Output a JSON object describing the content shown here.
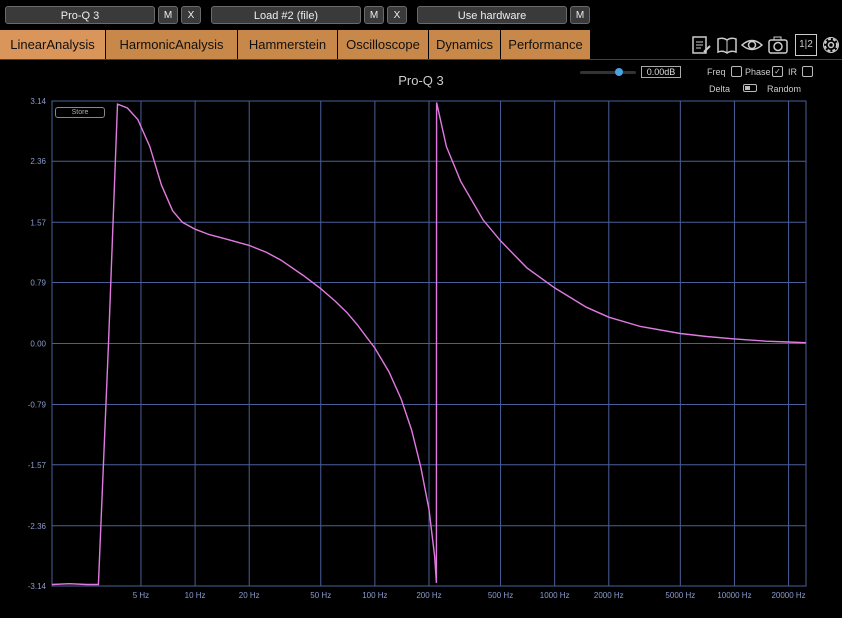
{
  "toolbar": {
    "plugin1_label": "Pro-Q 3",
    "plugin2_label": "Load #2 (file)",
    "hardware_label": "Use hardware",
    "m_label": "M",
    "x_label": "X"
  },
  "tabs": [
    {
      "label": "LinearAnalysis",
      "active": true
    },
    {
      "label": "HarmonicAnalysis",
      "active": false
    },
    {
      "label": "Hammerstein",
      "active": false
    },
    {
      "label": "Oscilloscope",
      "active": false
    },
    {
      "label": "Dynamics",
      "active": false
    },
    {
      "label": "Performance",
      "active": false
    }
  ],
  "icons": [
    "notes-icon",
    "book-icon",
    "eye-icon",
    "camera-icon",
    "split-view-icon",
    "gear-icon"
  ],
  "split_label": "1|2",
  "controls": {
    "gain_value": "0.00dB",
    "freq_label": "Freq",
    "phase_label": "Phase",
    "ir_label": "IR",
    "delta_label": "Delta",
    "random_label": "Random",
    "store_label": "Store"
  },
  "chart_data": {
    "type": "line",
    "title": "Pro-Q 3",
    "xscale": "log",
    "xlim": [
      1.6,
      25000
    ],
    "ylim": [
      -3.14,
      3.14
    ],
    "x_tick_labels": [
      "5 Hz",
      "10 Hz",
      "20 Hz",
      "50 Hz",
      "100 Hz",
      "200 Hz",
      "500 Hz",
      "1000 Hz",
      "2000 Hz",
      "5000 Hz",
      "10000 Hz",
      "20000 Hz"
    ],
    "x_ticks": [
      5,
      10,
      20,
      50,
      100,
      200,
      500,
      1000,
      2000,
      5000,
      10000,
      20000
    ],
    "y_ticks": [
      3.14,
      2.36,
      1.57,
      0.79,
      0.0,
      -0.79,
      -1.57,
      -2.36,
      -3.14
    ],
    "y_tick_labels": [
      "3.14",
      "2.36",
      "1.57",
      "0.79",
      "0.00",
      "-0.79",
      "-1.57",
      "-2.36",
      "-3.14"
    ],
    "grid": true,
    "line_color": "#e07ae0",
    "grid_color": "#4a5f99",
    "series": [
      {
        "values_x": [
          1.6,
          2.0,
          2.5,
          2.9,
          3.3,
          3.7,
          4.2,
          4.8,
          5.6,
          6.5,
          7.5,
          8.5,
          10,
          12,
          15,
          20,
          25,
          30,
          40,
          50,
          60,
          70,
          80,
          90,
          100,
          120,
          140,
          160,
          180,
          200,
          215,
          220,
          220.5,
          250,
          300,
          400,
          500,
          700,
          1000,
          1500,
          2000,
          3000,
          5000,
          7000,
          10000,
          15000,
          20000,
          25000
        ],
        "values_y": [
          -3.12,
          -3.11,
          -3.12,
          -3.12,
          0.0,
          3.1,
          3.05,
          2.9,
          2.55,
          2.05,
          1.72,
          1.57,
          1.48,
          1.41,
          1.35,
          1.27,
          1.18,
          1.08,
          0.88,
          0.71,
          0.55,
          0.4,
          0.24,
          0.08,
          -0.06,
          -0.37,
          -0.72,
          -1.12,
          -1.6,
          -2.15,
          -2.75,
          -3.1,
          3.12,
          2.55,
          2.1,
          1.6,
          1.33,
          0.98,
          0.72,
          0.47,
          0.34,
          0.22,
          0.13,
          0.09,
          0.06,
          0.03,
          0.02,
          0.01
        ]
      }
    ]
  }
}
